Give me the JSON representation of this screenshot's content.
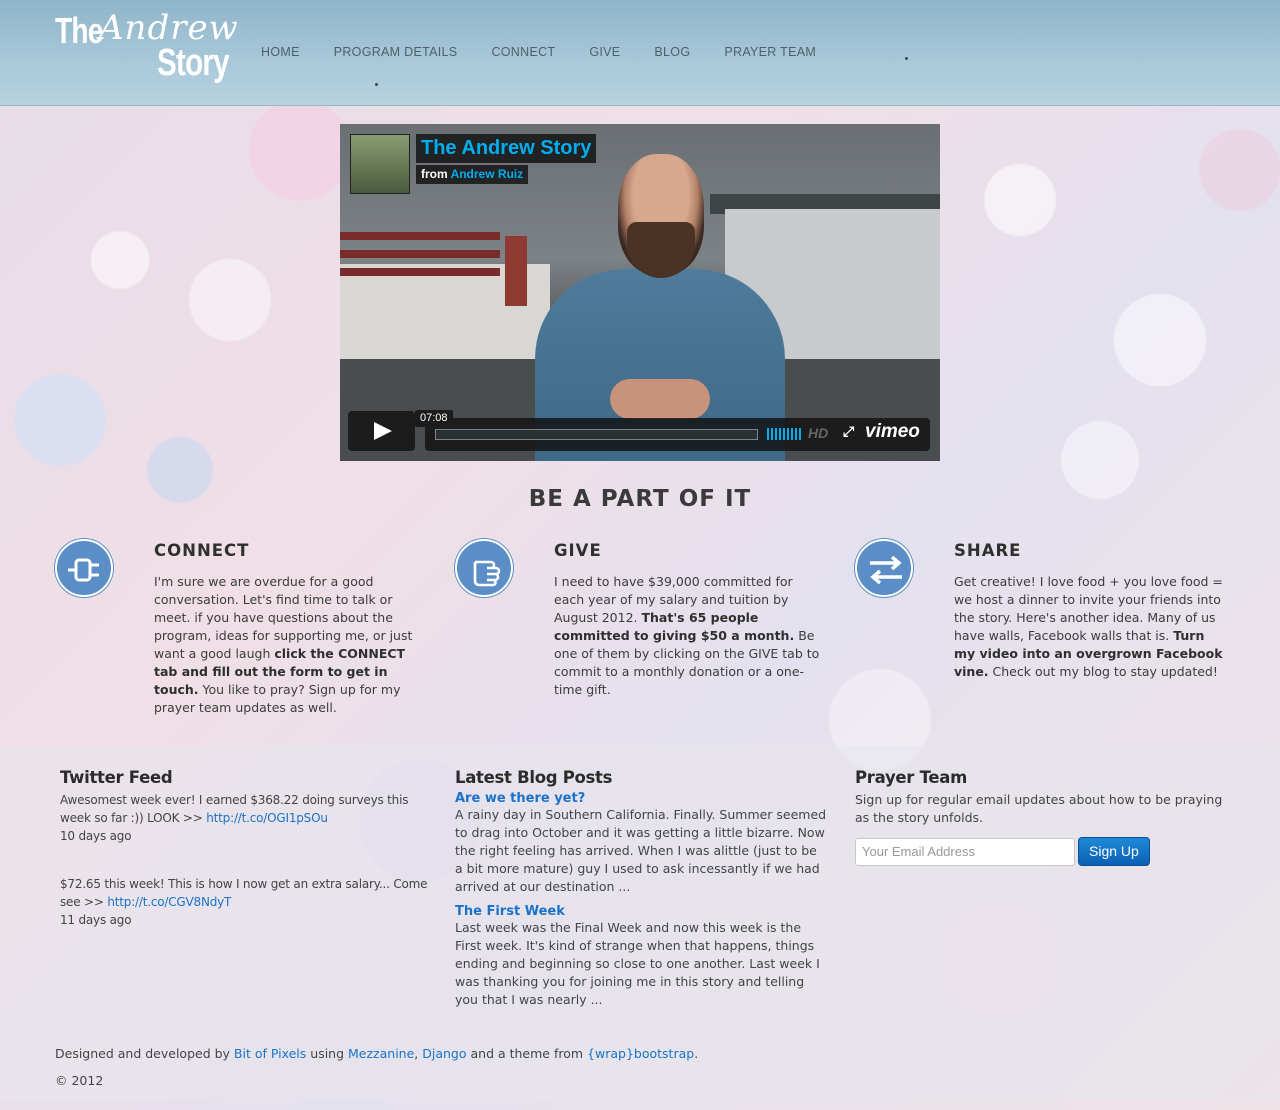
{
  "header": {
    "logo": {
      "the": "The",
      "andrew": "Andrew",
      "story": "Story"
    },
    "nav": [
      "HOME",
      "PROGRAM DETAILS",
      "CONNECT",
      "GIVE",
      "BLOG",
      "PRAYER TEAM"
    ]
  },
  "video": {
    "title": "The Andrew Story",
    "from": "from",
    "author": "Andrew Ruiz",
    "time": "07:08",
    "hd": "HD",
    "brand": "vimeo",
    "accent": "#00adef"
  },
  "section": {
    "title": "BE A PART OF IT"
  },
  "features": {
    "connect": {
      "icon": "plug-icon",
      "title": "CONNECT",
      "p1": "I'm sure we are overdue for a good conversation. Let's find time to talk or meet. if you have questions about the program, ideas for supporting me, or just want a good laugh ",
      "bold": "click the CONNECT tab and fill out the form to get in touch.",
      "p2": " You like to pray? Sign up for my prayer team updates as well."
    },
    "give": {
      "icon": "hand-icon",
      "title": "GIVE",
      "p1": "I need to have $39,000 committed for each year of my salary and tuition by August 2012. ",
      "bold": "That's 65 people committed to giving $50 a month.",
      "p2": " Be one of them by clicking on the GIVE tab to commit to a monthly donation or a one-time gift."
    },
    "share": {
      "icon": "swap-arrows-icon",
      "title": "SHARE",
      "p1": "Get creative! I love food + you love food = we host a dinner to invite your friends into the story. Here's another idea. Many of us have walls, Facebook walls that is. ",
      "bold": "Turn my video into an overgrown Facebook vine.",
      "p2": " Check out my blog to stay updated!"
    }
  },
  "twitter": {
    "title": "Twitter Feed",
    "tweets": [
      {
        "text": "Awesomest week ever! I earned $368.22 doing surveys this week so far :)) LOOK >> ",
        "link": "http://t.co/OGI1pSOu",
        "ago": "10 days ago"
      },
      {
        "text": "$72.65 this week! This is how I now get an extra salary... Come see >> ",
        "link": "http://t.co/CGV8NdyT",
        "ago": "11 days ago"
      }
    ]
  },
  "blog": {
    "title": "Latest Blog Posts",
    "posts": [
      {
        "title": "Are we there yet?",
        "excerpt": "A rainy day in Southern California. Finally. Summer seemed to drag into October and it was getting a little bizarre.  Now the right feeling has arrived. When I was alittle (just to be a bit more mature) guy I used to ask incessantly if we had arrived at our destination ..."
      },
      {
        "title": "The First Week",
        "excerpt": "Last week was the Final Week and now this week is the First week.  It's kind of strange when that happens, things ending and beginning so close to one another.  Last week I was thanking you for joining me in this story and telling you that I was nearly ..."
      }
    ]
  },
  "prayer": {
    "title": "Prayer Team",
    "intro": "Sign up for regular email updates about how to be praying as the story unfolds.",
    "placeholder": "Your Email Address",
    "button": "Sign Up"
  },
  "footer": {
    "designed": "Designed and developed by ",
    "bit": "Bit of Pixels",
    "using": " using ",
    "mezzanine": "Mezzanine",
    "comma": ", ",
    "django": "Django",
    "theme": " and a theme from ",
    "wrap": "{wrap}bootstrap",
    "period": ".",
    "copyright": "© 2012"
  }
}
